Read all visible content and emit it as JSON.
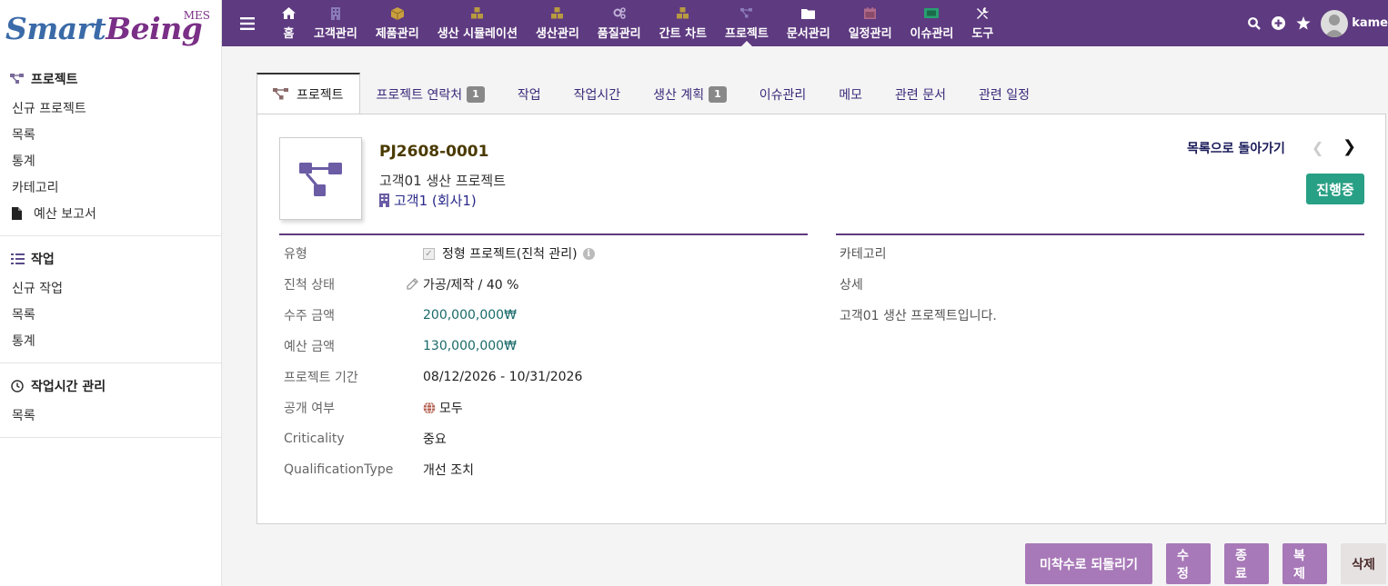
{
  "brand": {
    "part1": "Smart",
    "part2": "Being",
    "suffix": "MES"
  },
  "sidebar": {
    "sections": [
      {
        "title": "프로젝트",
        "icon": "project-icon",
        "items": [
          {
            "label": "신규 프로젝트"
          },
          {
            "label": "목록"
          },
          {
            "label": "통계"
          },
          {
            "label": "카테고리"
          },
          {
            "label": "예산 보고서",
            "icon": "file-icon"
          }
        ]
      },
      {
        "title": "작업",
        "icon": "tasks-icon",
        "items": [
          {
            "label": "신규 작업"
          },
          {
            "label": "목록"
          },
          {
            "label": "통계"
          }
        ]
      },
      {
        "title": "작업시간 관리",
        "icon": "clock-icon",
        "items": [
          {
            "label": "목록"
          }
        ]
      }
    ]
  },
  "navbar": {
    "items": [
      {
        "label": "홈",
        "icon": "home-icon"
      },
      {
        "label": "고객관리",
        "icon": "building-icon"
      },
      {
        "label": "제품관리",
        "icon": "box-icon"
      },
      {
        "label": "생산 시뮬레이션",
        "icon": "cubes-icon"
      },
      {
        "label": "생산관리",
        "icon": "cubes-icon"
      },
      {
        "label": "품질관리",
        "icon": "cogs-icon"
      },
      {
        "label": "간트 차트",
        "icon": "cubes-icon"
      },
      {
        "label": "프로젝트",
        "icon": "project-icon"
      },
      {
        "label": "문서관리",
        "icon": "folder-icon"
      },
      {
        "label": "일정관리",
        "icon": "calendar-icon"
      },
      {
        "label": "이슈관리",
        "icon": "ticket-icon"
      },
      {
        "label": "도구",
        "icon": "tools-icon"
      }
    ],
    "active_index": 7,
    "user_name": "kame"
  },
  "tabs": [
    {
      "label": "프로젝트",
      "icon": "project-icon",
      "active": true
    },
    {
      "label": "프로젝트 연락처",
      "badge": "1"
    },
    {
      "label": "작업"
    },
    {
      "label": "작업시간"
    },
    {
      "label": "생산 계획",
      "badge": "1"
    },
    {
      "label": "이슈관리"
    },
    {
      "label": "메모"
    },
    {
      "label": "관련 문서"
    },
    {
      "label": "관련 일정"
    }
  ],
  "project": {
    "code": "PJ2608-0001",
    "name": "고객01 생산 프로젝트",
    "client": "고객1 (회사1)",
    "back_label": "목록으로 돌아가기",
    "status": "진행중"
  },
  "fields": {
    "type": {
      "label": "유형",
      "value": "정형 프로젝트(진척 관리)"
    },
    "progress": {
      "label": "진척 상태",
      "value": "가공/제작 / 40 %"
    },
    "order_amount": {
      "label": "수주 금액",
      "value": "200,000,000₩"
    },
    "budget_amount": {
      "label": "예산 금액",
      "value": "130,000,000₩"
    },
    "period": {
      "label": "프로젝트 기간",
      "start": "08/12/2026",
      "sep": " - ",
      "end": "10/31/2026"
    },
    "visibility": {
      "label": "공개 여부",
      "value": "모두"
    },
    "criticality": {
      "label": "Criticality",
      "value": "중요"
    },
    "qualification": {
      "label": "QualificationType",
      "value": "개선 조치"
    }
  },
  "right_fields": {
    "category_label": "카테고리",
    "detail_label": "상세",
    "detail_value": "고객01 생산 프로젝트입니다."
  },
  "buttons": {
    "revert": "미착수로 되돌리기",
    "edit": "수정",
    "close": "종료",
    "clone": "복제",
    "delete": "삭제"
  },
  "colors": {
    "navbar": "#5e3a80",
    "status": "#28a085",
    "button": "#a879b8"
  }
}
